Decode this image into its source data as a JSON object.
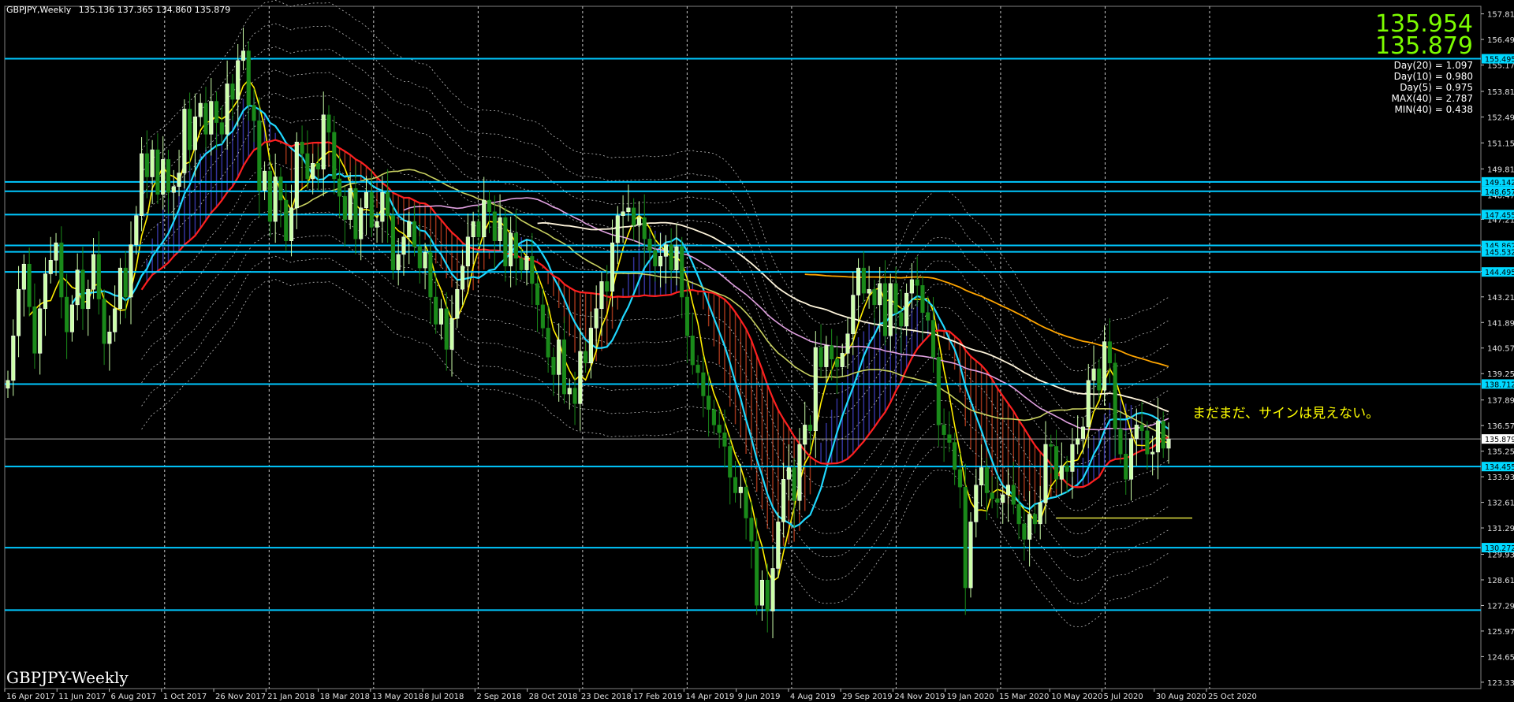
{
  "header": {
    "symbol_timeframe": "GBPJPY,Weekly",
    "ohlc": "135.136 137.365 134.860 135.879"
  },
  "prices": {
    "bid": "135.954",
    "ask": "135.879"
  },
  "stats": [
    "Day(20) = 1.097",
    "Day(10) = 0.980",
    "Day(5) = 0.975",
    "MAX(40) = 2.787",
    "MIN(40) = 0.438"
  ],
  "symbol_label": "GBPJPY-Weekly",
  "annotation": "まだまだ、サインは見えない。",
  "colors": {
    "background": "#000000",
    "bull_candle": "#ccffaa",
    "bear_candle": "#1a8a1a",
    "hline": "#00c8ff",
    "ma_red": "#ff2020",
    "ma_cyan": "#20d8ff",
    "ma_yellow": "#ffee00",
    "ma_orange": "#ffa500",
    "ma_white": "#fff5dc",
    "ma_pink": "#e0a0e0",
    "cloud_up": "#4040c0",
    "cloud_down": "#c04020",
    "price_tag": "#00d8ff"
  },
  "chart_data": {
    "type": "candlestick",
    "title": "",
    "ylim": [
      123.0,
      158.2
    ],
    "y_ticks": [
      "157.810",
      "156.490",
      "155.170",
      "153.810",
      "152.490",
      "151.150",
      "149.810",
      "148.470",
      "147.210",
      "145.810",
      "144.530",
      "143.210",
      "141.890",
      "140.570",
      "139.250",
      "137.890",
      "136.570",
      "135.250",
      "133.930",
      "132.610",
      "131.290",
      "129.930",
      "128.610",
      "127.290",
      "125.970",
      "124.650",
      "123.330"
    ],
    "x_labels": [
      "16 Apr 2017",
      "11 Jun 2017",
      "6 Aug 2017",
      "1 Oct 2017",
      "26 Nov 2017",
      "21 Jan 2018",
      "18 Mar 2018",
      "13 May 2018",
      "8 Jul 2018",
      "2 Sep 2018",
      "28 Oct 2018",
      "23 Dec 2018",
      "17 Feb 2019",
      "14 Apr 2019",
      "9 Jun 2019",
      "4 Aug 2019",
      "29 Sep 2019",
      "24 Nov 2019",
      "19 Jan 2020",
      "15 Mar 2020",
      "10 May 2020",
      "5 Jul 2020",
      "30 Aug 2020",
      "25 Oct 2020"
    ],
    "horizontal_levels": [
      {
        "value": 155.495,
        "label": "155.495"
      },
      {
        "value": 149.142,
        "label": "149.142"
      },
      {
        "value": 148.657,
        "label": "148.657"
      },
      {
        "value": 147.455,
        "label": "147.455"
      },
      {
        "value": 145.862,
        "label": "145.862"
      },
      {
        "value": 145.532,
        "label": "145.532"
      },
      {
        "value": 144.495,
        "label": "144.495"
      },
      {
        "value": 138.712,
        "label": "138.712"
      },
      {
        "value": 134.455,
        "label": "134.455"
      },
      {
        "value": 130.272,
        "label": "130.272"
      },
      {
        "value": 127.05,
        "label": ""
      }
    ],
    "current_price": {
      "value": 135.879,
      "label": "135.879"
    },
    "vertical_grid_dates": [
      "1 Oct 2017",
      "21 Jan 2018",
      "13 May 2018",
      "2 Sep 2018",
      "23 Dec 2018",
      "14 Apr 2019",
      "4 Aug 2019",
      "24 Nov 2019",
      "15 Mar 2020",
      "5 Jul 2020",
      "25 Oct 2020"
    ],
    "close_series": [
      138.9,
      141.2,
      143.6,
      144.9,
      142.7,
      140.3,
      142.6,
      144.4,
      145.1,
      146.0,
      143.2,
      141.4,
      142.8,
      144.6,
      142.6,
      143.6,
      145.4,
      143.1,
      140.8,
      141.4,
      142.6,
      144.7,
      143.2,
      145.9,
      147.4,
      150.6,
      149.4,
      150.8,
      148.5,
      150.3,
      148.6,
      148.9,
      149.6,
      152.9,
      150.8,
      152.5,
      153.2,
      151.6,
      153.3,
      152.2,
      151.6,
      154.2,
      153.4,
      155.4,
      155.9,
      153.1,
      152.3,
      148.7,
      149.7,
      147.1,
      149.4,
      148.2,
      146.1,
      147.8,
      151.2,
      150.6,
      149.3,
      150.1,
      149.8,
      152.6,
      151.7,
      149.3,
      148.4,
      147.2,
      148.8,
      146.2,
      147.8,
      148.6,
      146.8,
      147.1,
      148.6,
      147.4,
      144.6,
      145.4,
      146.3,
      147.1,
      145.8,
      144.7,
      145.5,
      143.2,
      141.8,
      142.6,
      140.5,
      142.1,
      143.6,
      144.8,
      146.3,
      147.1,
      146.3,
      148.2,
      147.6,
      146.1,
      147.3,
      144.8,
      146.5,
      145.2,
      144.6,
      145.3,
      143.9,
      142.8,
      141.6,
      140.1,
      139.2,
      141.0,
      138.2,
      138.5,
      137.7,
      140.4,
      139.8,
      141.6,
      142.6,
      144.0,
      143.5,
      146.0,
      147.4,
      147.6,
      147.8,
      146.9,
      147.3,
      146.2,
      145.6,
      144.8,
      145.3,
      145.9,
      144.6,
      145.8,
      143.2,
      141.2,
      139.7,
      139.3,
      138.1,
      137.4,
      136.6,
      136.2,
      135.5,
      133.9,
      133.1,
      133.4,
      131.8,
      130.6,
      127.3,
      128.6,
      127.0,
      129.2,
      131.6,
      133.8,
      134.4,
      132.7,
      135.6,
      136.6,
      136.3,
      140.6,
      139.6,
      140.7,
      140.0,
      139.6,
      140.3,
      141.3,
      143.3,
      144.7,
      143.4,
      143.6,
      142.8,
      143.9,
      141.2,
      143.9,
      142.4,
      141.7,
      143.4,
      144.1,
      143.8,
      142.4,
      142.0,
      140.1,
      136.6,
      136.1,
      135.7,
      134.3,
      133.4,
      128.2,
      131.6,
      133.5,
      134.4,
      133.1,
      132.8,
      132.6,
      133.0,
      133.5,
      132.5,
      131.5,
      130.7,
      132.0,
      131.5,
      132.6,
      135.6,
      135.5,
      133.8,
      134.5,
      134.2,
      135.6,
      135.9,
      136.5,
      138.9,
      139.5,
      138.4,
      140.9,
      139.8,
      136.4,
      135.1,
      133.8,
      135.9,
      136.6,
      136.3,
      135.1,
      135.2,
      136.8,
      135.4,
      135.879
    ]
  }
}
